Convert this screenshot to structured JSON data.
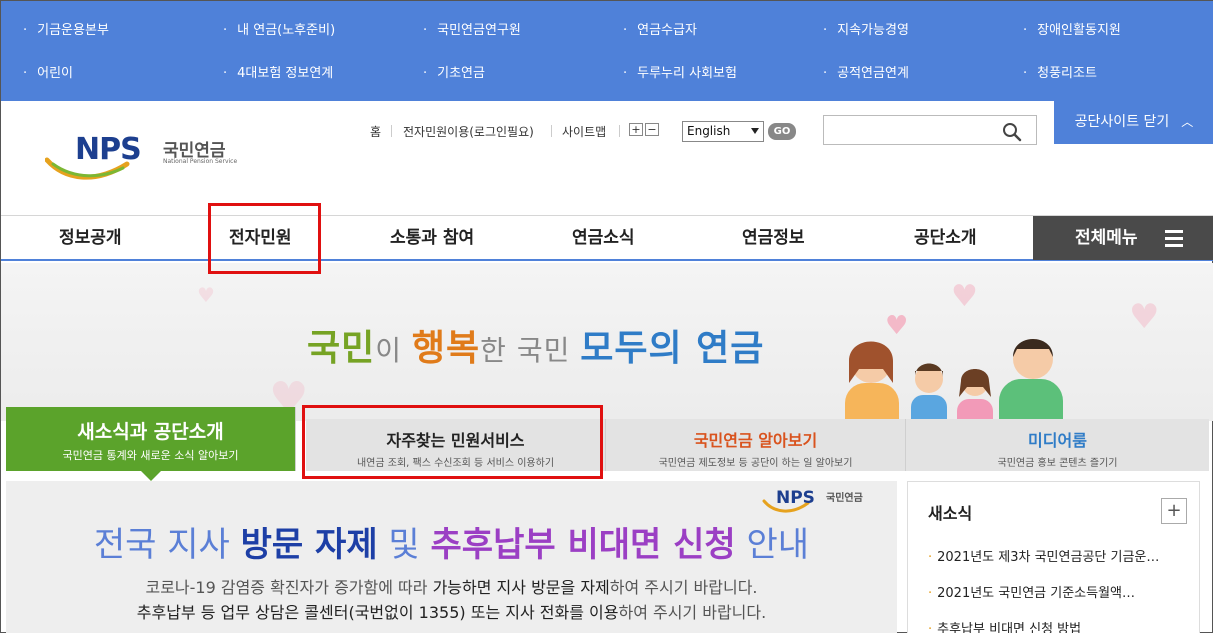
{
  "top_links": [
    [
      "기금운용본부",
      "내 연금(노후준비)",
      "국민연금연구원",
      "연금수급자",
      "지속가능경영",
      "장애인활동지원"
    ],
    [
      "어린이",
      "4대보험 정보연계",
      "기초연금",
      "두루누리 사회보험",
      "공적연금연계",
      "청풍리조트"
    ]
  ],
  "logo": {
    "brand": "NPS",
    "name_ko": "국민연금",
    "name_en": "National Pension Service"
  },
  "util": {
    "home": "홈",
    "civil": "전자민원이용(로그인필요)",
    "sitemap": "사이트맵",
    "zoom_in": "+",
    "zoom_out": "−",
    "language": "English",
    "go": "GO"
  },
  "search": {
    "placeholder": ""
  },
  "close_site": "공단사이트 닫기",
  "gnb": [
    "정보공개",
    "전자민원",
    "소통과 참여",
    "연금소식",
    "연금정보",
    "공단소개"
  ],
  "all_menu": "전체메뉴",
  "slogan": {
    "w1": "국민",
    "w2": "이 ",
    "w3": "행복",
    "w4": "한 국민 ",
    "w5": "모두의 연금"
  },
  "tabs": [
    {
      "title": "새소식과 공단소개",
      "sub": "국민연금 통계와 새로운 소식 알아보기"
    },
    {
      "title": "자주찾는 민원서비스",
      "sub": "내연금 조회, 팩스 수신조회 등 서비스 이용하기"
    },
    {
      "title": "국민연금 알아보기",
      "sub": "국민연금 제도정보 등 공단이 하는 일 알아보기"
    },
    {
      "title": "미디어룸",
      "sub": "국민연금 홍보 콘텐츠 즐기기"
    }
  ],
  "notice": {
    "logo": "NPS 국민연금",
    "h1": "전국 지사 ",
    "h2": "방문 자제",
    "h3": " 및 ",
    "h4": "추후납부 비대면 신청",
    "h5": " 안내",
    "l1a": "코로나-19 감염증 확진자가 증가함에 따라 ",
    "l1b": "가능하면 지사 방문을 자제",
    "l1c": "하여 주시기 바랍니다.",
    "l2a": "추후납부 등 업무 상담은 콜센터(국번없이 1355) 또는 지사 전화를 이용",
    "l2b": "하여 주시기 바랍니다."
  },
  "news": {
    "title": "새소식",
    "items": [
      "2021년도 제3차 국민연금공단 기금운…",
      "2021년도 국민연금 기준소득월액…",
      "추후납부 비대면 신청 방법"
    ]
  },
  "colors": {
    "top_bar": "#4f81d9",
    "active_tab": "#5ba32b",
    "highlight": "#e01010"
  }
}
